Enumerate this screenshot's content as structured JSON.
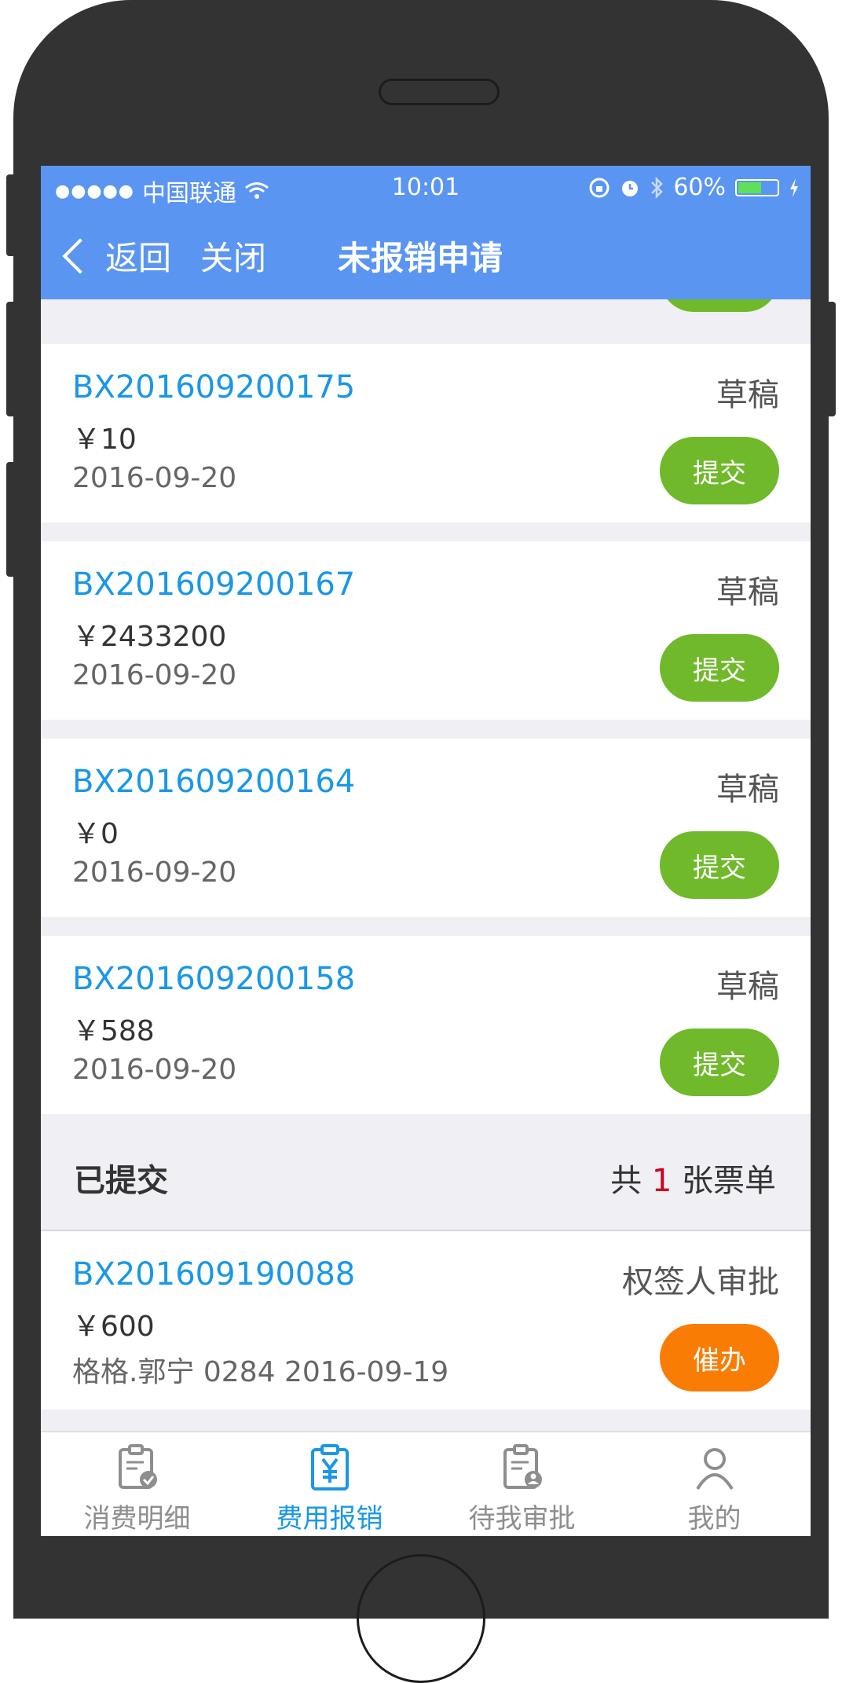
{
  "status_bar": {
    "signal_dots": "●●●●●",
    "carrier": "中国联通",
    "time": "10:01",
    "battery_text": "60%",
    "battery_level": 0.6
  },
  "nav": {
    "back_label": "返回",
    "close_label": "关闭",
    "title": "未报销申请"
  },
  "drafts": [
    {
      "no": "BX201609200175",
      "amount": "￥10",
      "date": "2016-09-20",
      "status": "草稿",
      "action": "提交"
    },
    {
      "no": "BX201609200167",
      "amount": "￥2433200",
      "date": "2016-09-20",
      "status": "草稿",
      "action": "提交"
    },
    {
      "no": "BX201609200164",
      "amount": "￥0",
      "date": "2016-09-20",
      "status": "草稿",
      "action": "提交"
    },
    {
      "no": "BX201609200158",
      "amount": "￥588",
      "date": "2016-09-20",
      "status": "草稿",
      "action": "提交"
    }
  ],
  "submitted_section": {
    "title": "已提交",
    "count_prefix": "共",
    "count": "1",
    "count_suffix": "张票单"
  },
  "submitted": [
    {
      "no": "BX201609190088",
      "amount": "￥600",
      "meta": "格格.郭宁 0284 2016-09-19",
      "status": "权签人审批",
      "action": "催办"
    }
  ],
  "tabs": [
    {
      "label": "消费明细",
      "icon": "clipboard-check-icon",
      "active": false
    },
    {
      "label": "费用报销",
      "icon": "clipboard-yen-icon",
      "active": true
    },
    {
      "label": "待我审批",
      "icon": "clipboard-user-icon",
      "active": false
    },
    {
      "label": "我的",
      "icon": "user-icon",
      "active": false
    }
  ],
  "colors": {
    "header": "#5b95f2",
    "link_blue": "#1a97e6",
    "submit_green": "#6fb92b",
    "urge_orange": "#f97c05",
    "count_red": "#d0021b"
  }
}
